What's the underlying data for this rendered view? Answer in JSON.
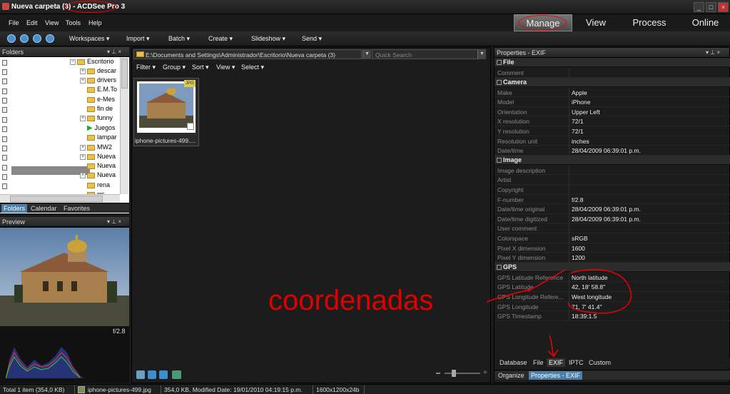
{
  "window": {
    "title": "Nueva carpeta (3)",
    "app_name": "ACDSee Pro 3",
    "title_separator": " - "
  },
  "menu": [
    "File",
    "Edit",
    "View",
    "Tools",
    "Help"
  ],
  "modes": [
    "Manage",
    "View",
    "Process",
    "Online"
  ],
  "toolbar": [
    "Workspaces ▾",
    "Import ▾",
    "Batch ▾",
    "Create ▾",
    "Slideshow ▾",
    "Send ▾"
  ],
  "folders": {
    "title": "Folders",
    "items": [
      "Escritorio",
      "descar",
      "drivers",
      "E.M.To",
      "e-Mes",
      "fin de",
      "funny",
      "Juegos",
      "lampar",
      "MW2",
      "Nueva",
      "Nueva",
      "Nueva",
      "rena",
      "rrs"
    ],
    "tabs": [
      "Folders",
      "Calendar",
      "Favorites"
    ]
  },
  "preview": {
    "title": "Preview",
    "fnumber": "f/2.8"
  },
  "filelist": {
    "path": "E:\\Documents and Settings\\Administrador\\Escritorio\\Nueva carpeta (3)",
    "search_placeholder": "Quick Search",
    "filters": [
      "Filter ▾",
      "Group ▾",
      "Sort ▾",
      "View ▾",
      "Select ▾"
    ],
    "thumb_label": "iphone-pictures-499....",
    "thumb_badge": "JPG"
  },
  "properties": {
    "title": "Properties - EXIF",
    "sections": {
      "file": "File",
      "camera": "Camera",
      "image": "Image",
      "gps": "GPS"
    },
    "file_rows": [
      {
        "k": "Comment",
        "v": ""
      }
    ],
    "camera_rows": [
      {
        "k": "Make",
        "v": "Apple"
      },
      {
        "k": "Model",
        "v": "iPhone"
      },
      {
        "k": "Orientation",
        "v": "Upper Left"
      },
      {
        "k": "X resolution",
        "v": "72/1"
      },
      {
        "k": "Y resolution",
        "v": "72/1"
      },
      {
        "k": "Resolution unit",
        "v": "inches"
      },
      {
        "k": "Date/time",
        "v": "28/04/2009 06:39:01 p.m."
      }
    ],
    "image_rows": [
      {
        "k": "Image description",
        "v": ""
      },
      {
        "k": "Artist",
        "v": ""
      },
      {
        "k": "Copyright",
        "v": ""
      },
      {
        "k": "F-number",
        "v": "f/2.8"
      },
      {
        "k": "Date/time original",
        "v": "28/04/2009 06:39:01 p.m."
      },
      {
        "k": "Date/time digitized",
        "v": "28/04/2009 06:39:01 p.m."
      },
      {
        "k": "User comment",
        "v": ""
      },
      {
        "k": "Colorspace",
        "v": "sRGB"
      },
      {
        "k": "Pixel X dimension",
        "v": "1600"
      },
      {
        "k": "Pixel Y dimension",
        "v": "1200"
      }
    ],
    "gps_rows": [
      {
        "k": "GPS Latitude Reference",
        "v": "North latitude"
      },
      {
        "k": "GPS Latitude",
        "v": "42, 18' 58.8''"
      },
      {
        "k": "GPS Longitude Refere...",
        "v": "West longitude"
      },
      {
        "k": "GPS Longitude",
        "v": "71, 7' 41.4''"
      },
      {
        "k": "GPS Timestamp",
        "v": "18:39:1.5"
      }
    ],
    "tabs": [
      "Database",
      "File",
      "EXIF",
      "IPTC",
      "Custom"
    ],
    "bottom_tabs": [
      "Organize",
      "Properties - EXIF"
    ]
  },
  "annotation": "coordenadas",
  "status": {
    "total": "Total 1 item  (354,0 KB)",
    "filename": "iphone-pictures-499.jpg",
    "info": "354,0 KB, Modified Date: 19/01/2010 04:19:15 p.m.",
    "dims": "1600x1200x24b"
  },
  "colors": {
    "accent": "#4b7ea8",
    "annotation": "#e00000"
  }
}
